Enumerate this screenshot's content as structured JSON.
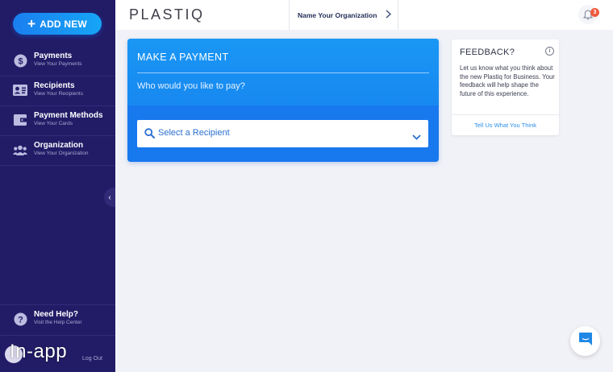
{
  "sidebar": {
    "add_new": "ADD NEW",
    "items": [
      {
        "title": "Payments",
        "subtitle": "View Your Payments",
        "icon": "dollar-circle-icon"
      },
      {
        "title": "Recipients",
        "subtitle": "View Your Recipients",
        "icon": "contact-card-icon"
      },
      {
        "title": "Payment Methods",
        "subtitle": "View Your Cards",
        "icon": "wallet-icon"
      },
      {
        "title": "Organization",
        "subtitle": "View Your Organization",
        "icon": "people-icon"
      }
    ],
    "help": {
      "title": "Need Help?",
      "subtitle": "Visit the Help Center",
      "icon": "question-circle-icon"
    },
    "logout": "Log Out",
    "watermark": "In-app",
    "collapse_icon": "chevron-left-icon"
  },
  "header": {
    "logo": "PLASTIQ",
    "org_selector": "Name Your Organization",
    "notification_count": "3"
  },
  "payment": {
    "title": "MAKE A PAYMENT",
    "subtitle": "Who would you like to pay?",
    "recipient_placeholder": "Select a Recipient"
  },
  "feedback": {
    "title": "FEEDBACK?",
    "body": "Let us know what you think about the new Plastiq for Business. Your feedback will help shape the future of this experience.",
    "link": "Tell Us What You Think"
  },
  "colors": {
    "sidebar_bg": "#221c67",
    "accent_blue": "#1a8ff3",
    "badge_red": "#ee5a3c"
  }
}
